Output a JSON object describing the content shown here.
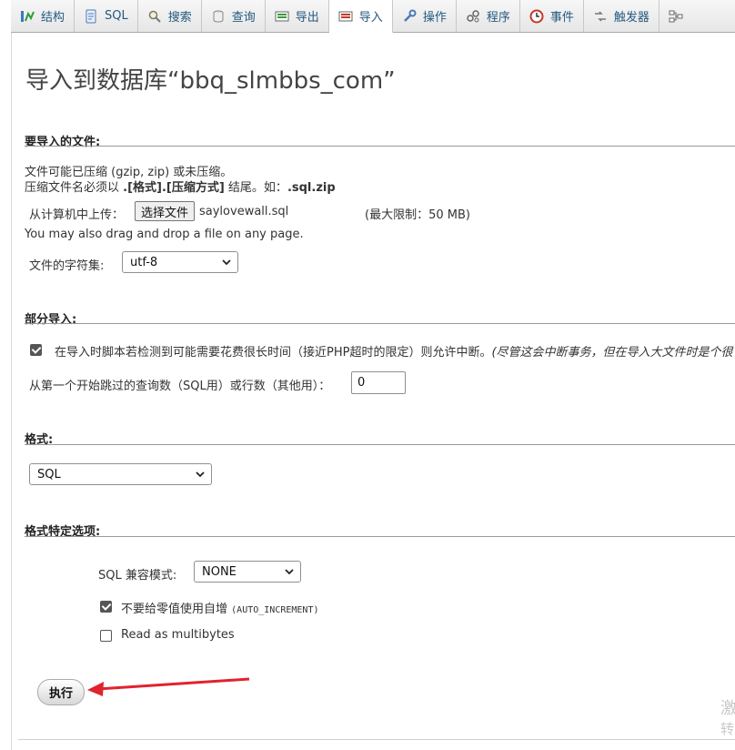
{
  "tabs": [
    {
      "label": "结构",
      "icon": "structure-icon",
      "active": false
    },
    {
      "label": "SQL",
      "icon": "sql-icon",
      "active": false
    },
    {
      "label": "搜索",
      "icon": "search-icon",
      "active": false
    },
    {
      "label": "查询",
      "icon": "query-icon",
      "active": false
    },
    {
      "label": "导出",
      "icon": "export-icon",
      "active": false
    },
    {
      "label": "导入",
      "icon": "import-icon",
      "active": true
    },
    {
      "label": "操作",
      "icon": "wrench-icon",
      "active": false
    },
    {
      "label": "程序",
      "icon": "routines-icon",
      "active": false
    },
    {
      "label": "事件",
      "icon": "clock-icon",
      "active": false
    },
    {
      "label": "触发器",
      "icon": "trigger-icon",
      "active": false
    }
  ],
  "page": {
    "title": "导入到数据库“bbq_slmbbs_com”"
  },
  "file_section": {
    "title": "要导入的文件:",
    "note1": "文件可能已压缩 (gzip, zip) 或未压缩。",
    "note2_prefix": "压缩文件名必须以 ",
    "note2_bold": ".[格式].[压缩方式]",
    "note2_mid": " 结尾。如：",
    "note2_example": ".sql.zip",
    "upload_label": "从计算机中上传：",
    "choose_button": "选择文件",
    "filename": "saylovewall.sql",
    "max_limit": "(最大限制：50 MB)",
    "drag_note": "You may also drag and drop a file on any page.",
    "charset_label": "文件的字符集:",
    "charset_value": "utf-8"
  },
  "partial_section": {
    "title": "部分导入:",
    "allow_interrupt_label": "在导入时脚本若检测到可能需要花费很长时间（接近PHP超时的限定）则允许中断。",
    "allow_interrupt_note": "(尽管这会中断事务，但在导入大文件时是个很",
    "allow_interrupt_checked": true,
    "skip_label": "从第一个开始跳过的查询数（SQL用）或行数（其他用）：",
    "skip_value": "0"
  },
  "format_section": {
    "title": "格式:",
    "value": "SQL"
  },
  "format_options": {
    "title": "格式特定选项:",
    "compat_label": "SQL 兼容模式:",
    "compat_value": "NONE",
    "no_auto_value_label": "不要给零值使用自增",
    "no_auto_value_code": "(AUTO_INCREMENT)",
    "no_auto_value_checked": true,
    "multibytes_label": "Read as multibytes",
    "multibytes_checked": false
  },
  "actions": {
    "go_label": "执行"
  },
  "annotation": {
    "arrow_color": "#e0232d"
  },
  "watermark": {
    "line1": "激",
    "line2": "转"
  }
}
